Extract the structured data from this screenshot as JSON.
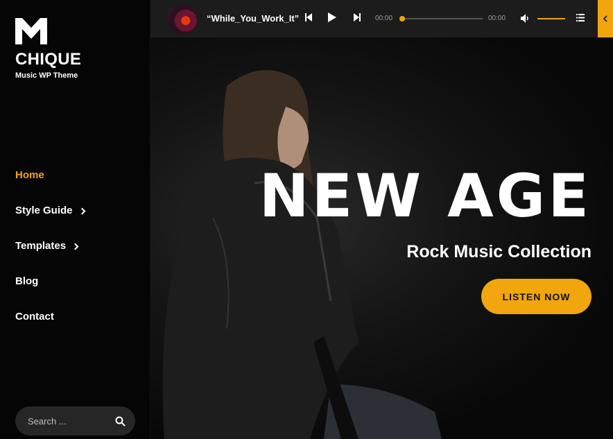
{
  "sidebar": {
    "brand": "CHIQUE",
    "tagline": "Music WP Theme",
    "nav": [
      {
        "label": "Home",
        "active": true
      },
      {
        "label": "Style Guide",
        "has_submenu": true
      },
      {
        "label": "Templates",
        "has_submenu": true
      },
      {
        "label": "Blog"
      },
      {
        "label": "Contact"
      }
    ],
    "search": {
      "placeholder": "Search ..."
    }
  },
  "player": {
    "track_title": "“While_You_Work_It”",
    "current_time": "00:00",
    "duration": "00:00",
    "progress": 0,
    "volume": 1.0
  },
  "hero": {
    "title": "NEW AGE",
    "subtitle": "Rock Music Collection",
    "cta_label": "LISTEN NOW"
  },
  "colors": {
    "accent": "#f2a60d",
    "background": "#000000",
    "player_bar": "#1c1c1c"
  },
  "icons": [
    "logo-m-icon",
    "previous-icon",
    "play-icon",
    "next-icon",
    "volume-icon",
    "playlist-icon",
    "collapse-arrow-icon",
    "search-icon"
  ]
}
